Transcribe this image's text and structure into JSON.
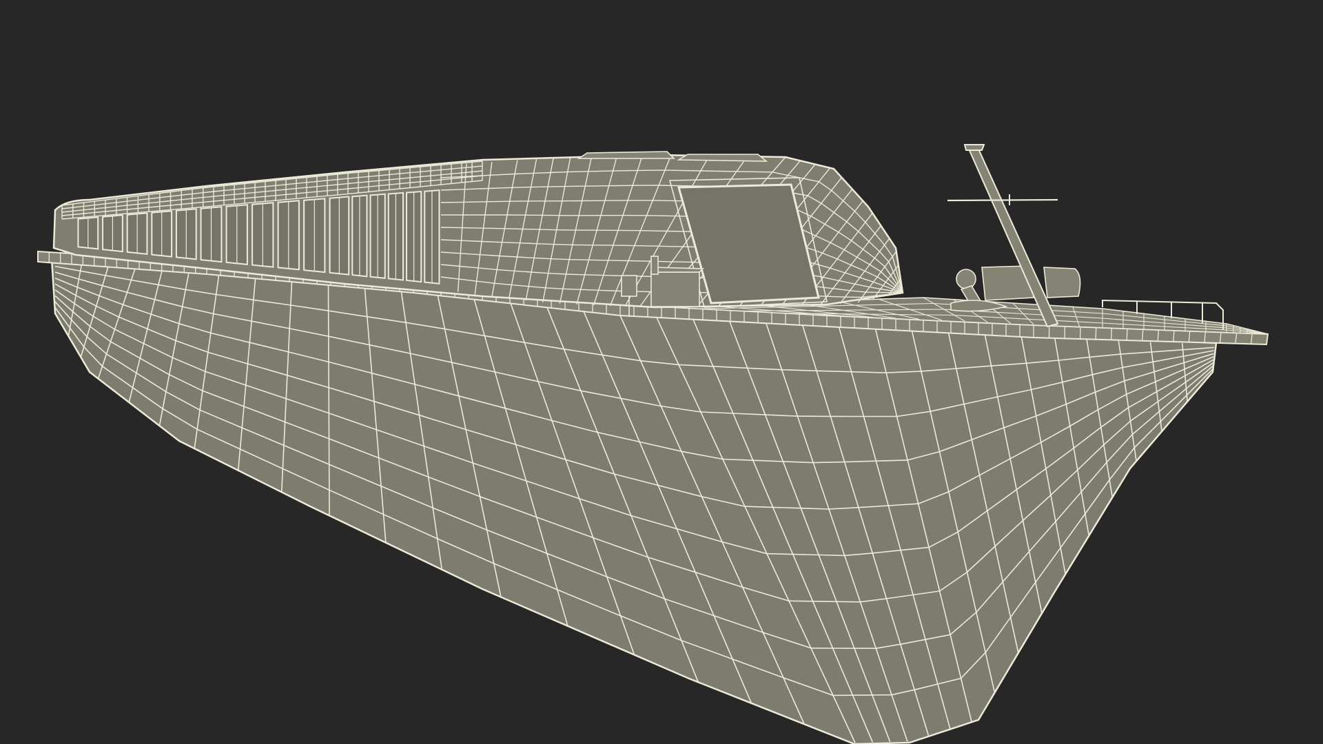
{
  "scene": {
    "background_color": "#272727",
    "model_fill_color": "#7d7c6e",
    "model_fill_shadow": "#6f6e61",
    "glass_fill_color": "#757468",
    "wireframe_color": "#ecebd9"
  }
}
